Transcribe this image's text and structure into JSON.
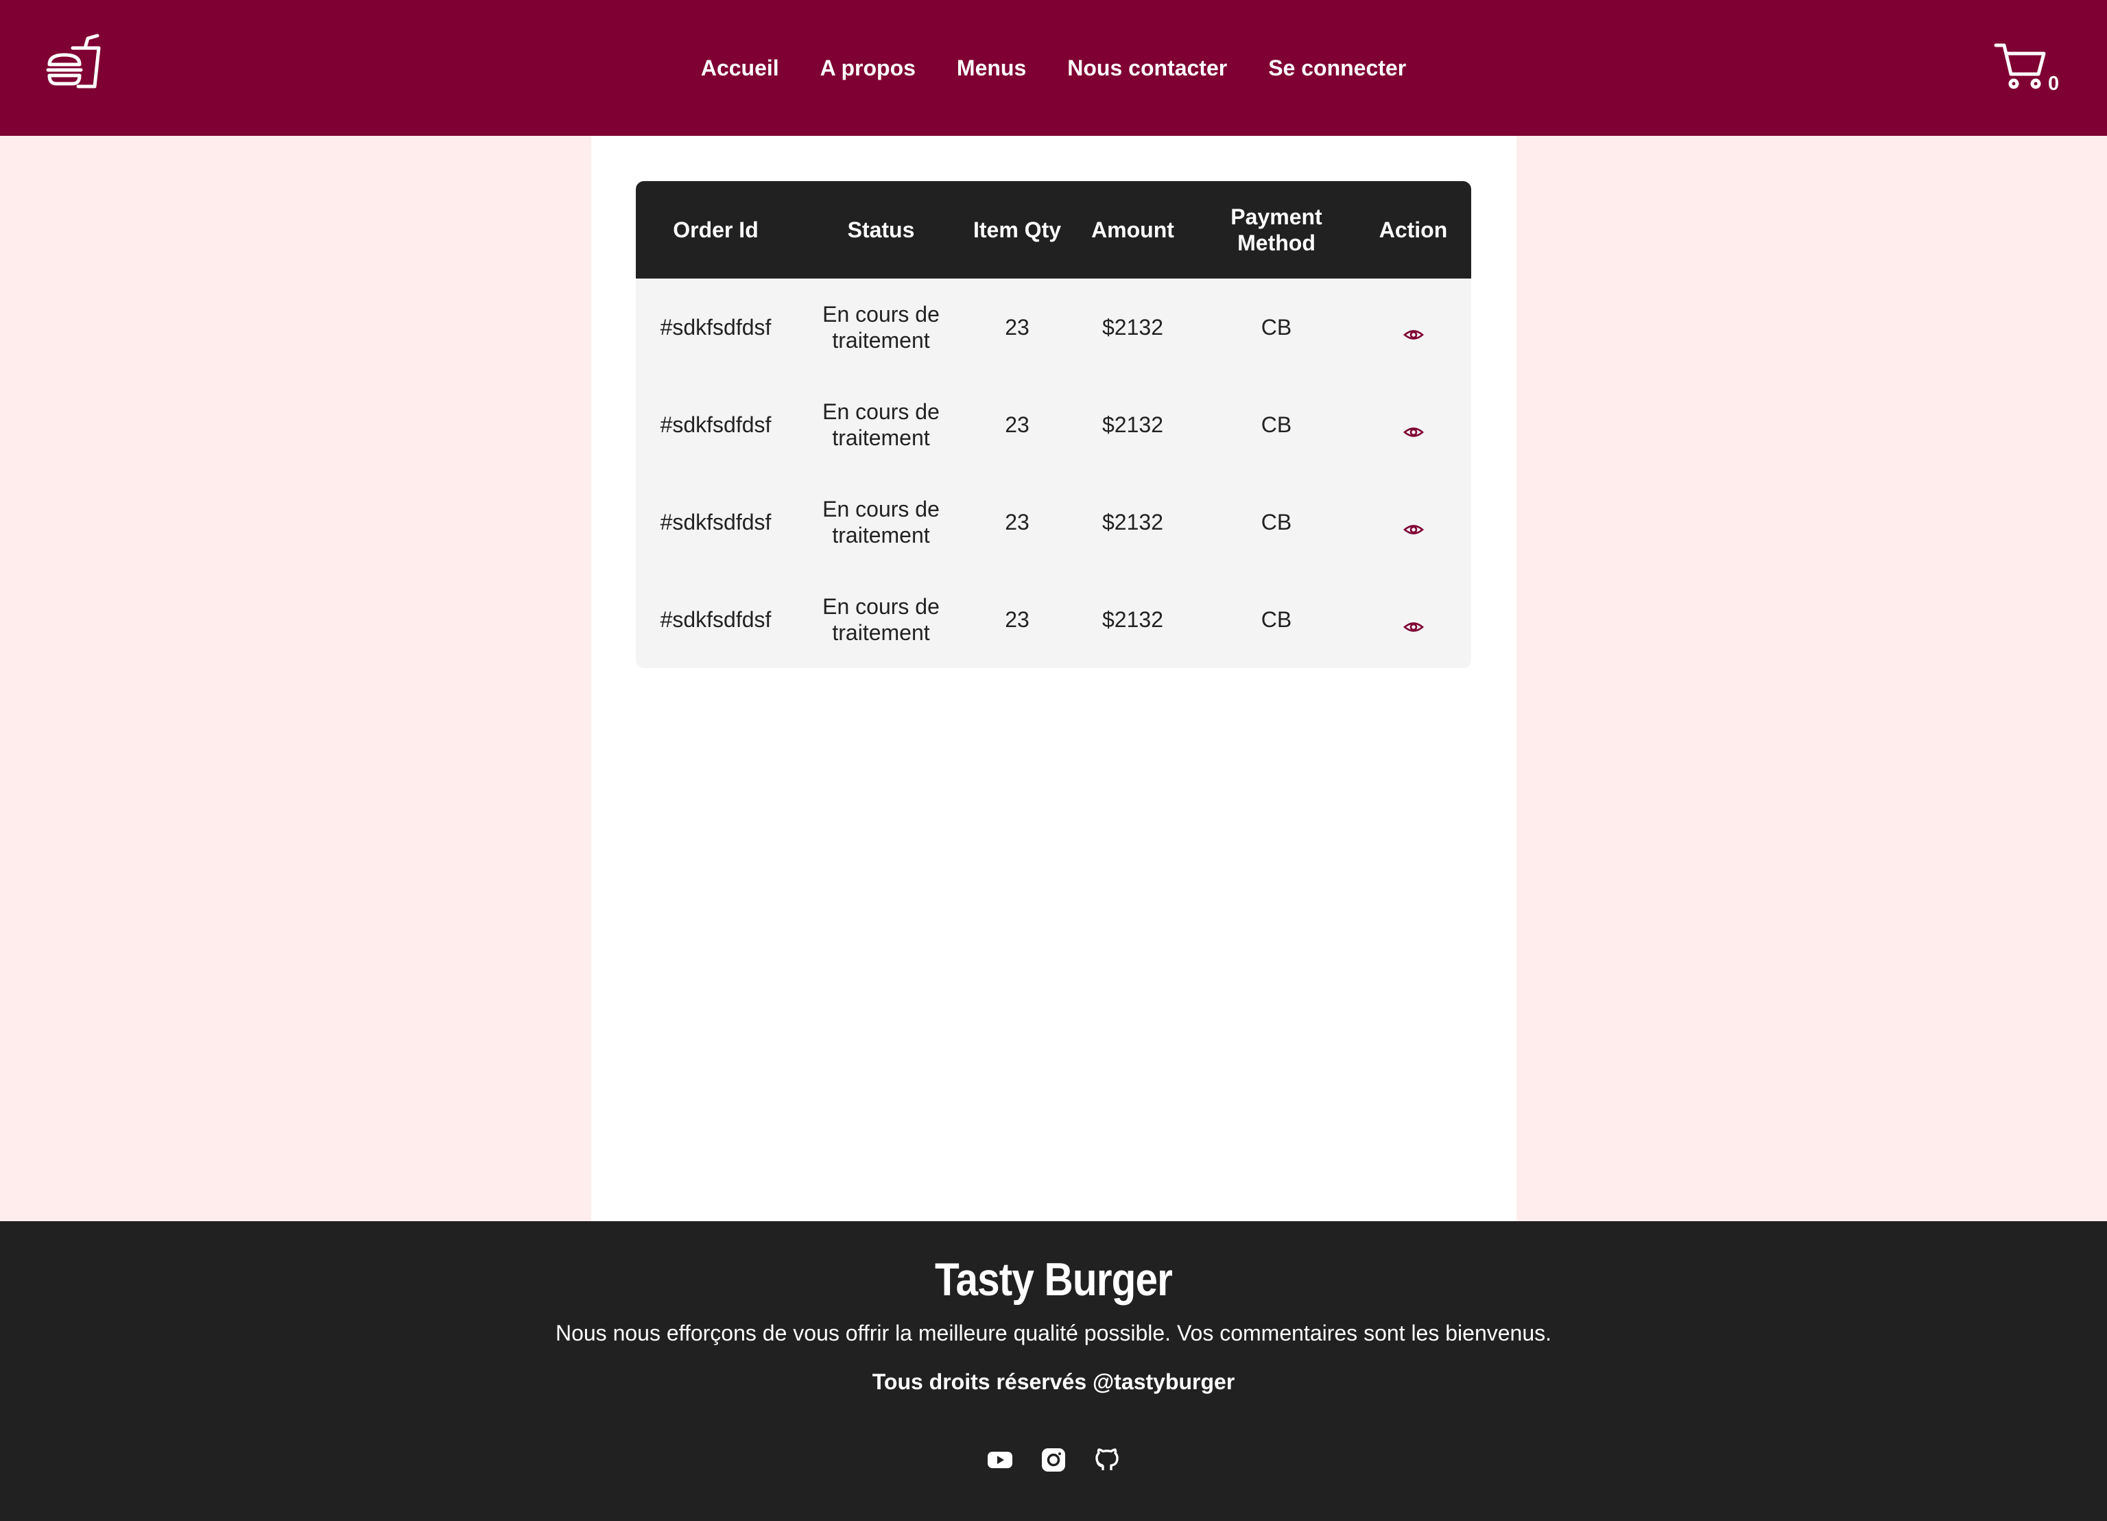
{
  "header": {
    "logo_icon": "burger-drink-icon",
    "nav": [
      "Accueil",
      "A propos",
      "Menus",
      "Nous contacter",
      "Se connecter"
    ],
    "cart": {
      "icon": "cart-icon",
      "count": "0"
    }
  },
  "orders": {
    "columns": [
      "Order Id",
      "Status",
      "Item Qty",
      "Amount",
      "Payment Method",
      "Action"
    ],
    "rows": [
      {
        "id": "#sdkfsdfdsf",
        "status": "En cours de traitement",
        "qty": "23",
        "amount": "$2132",
        "payment": "CB"
      },
      {
        "id": "#sdkfsdfdsf",
        "status": "En cours de traitement",
        "qty": "23",
        "amount": "$2132",
        "payment": "CB"
      },
      {
        "id": "#sdkfsdfdsf",
        "status": "En cours de traitement",
        "qty": "23",
        "amount": "$2132",
        "payment": "CB"
      },
      {
        "id": "#sdkfsdfdsf",
        "status": "En cours de traitement",
        "qty": "23",
        "amount": "$2132",
        "payment": "CB"
      }
    ],
    "action_icon": "eye-icon"
  },
  "footer": {
    "brand": "Tasty Burger",
    "tagline": "Nous nous efforçons de vous offrir la meilleure qualité possible. Vos commentaires sont les bienvenus.",
    "rights": "Tous droits réservés @tastyburger",
    "socials": [
      "youtube-icon",
      "instagram-icon",
      "github-icon"
    ]
  },
  "colors": {
    "brand": "#7f0032",
    "dark": "#212121",
    "side": "#ffeded",
    "table_bg": "#f4f4f4"
  }
}
